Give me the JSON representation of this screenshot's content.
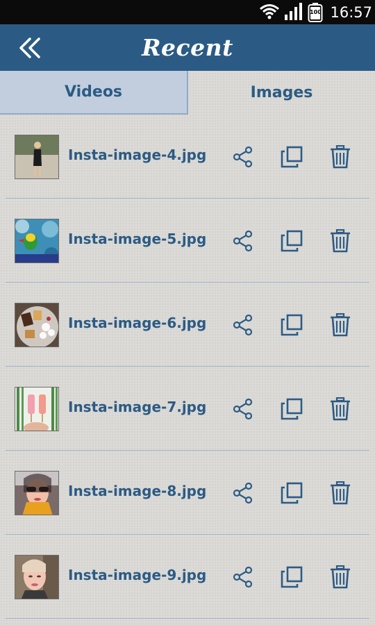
{
  "status_bar": {
    "time": "16:57",
    "battery_level": "100",
    "icons": [
      "wifi-icon",
      "signal-icon",
      "battery-icon"
    ]
  },
  "app_bar": {
    "title": "Recent",
    "back_icon": "double-chevron-left-icon",
    "color": "#2b5b85"
  },
  "tabs": [
    {
      "label": "Videos",
      "selected": true
    },
    {
      "label": "Images",
      "selected": false
    }
  ],
  "files": [
    {
      "name": "Insta-image-4.jpg",
      "thumb": "woman-standing-photo"
    },
    {
      "name": "Insta-image-5.jpg",
      "thumb": "parrot-bokeh-photo"
    },
    {
      "name": "Insta-image-6.jpg",
      "thumb": "smores-plate-photo"
    },
    {
      "name": "Insta-image-7.jpg",
      "thumb": "popsicles-photo"
    },
    {
      "name": "Insta-image-8.jpg",
      "thumb": "woman-sunglasses-selfie-photo"
    },
    {
      "name": "Insta-image-9.jpg",
      "thumb": "woman-selfie-photo"
    }
  ],
  "row_actions": [
    "share-icon",
    "copy-icon",
    "trash-icon"
  ]
}
